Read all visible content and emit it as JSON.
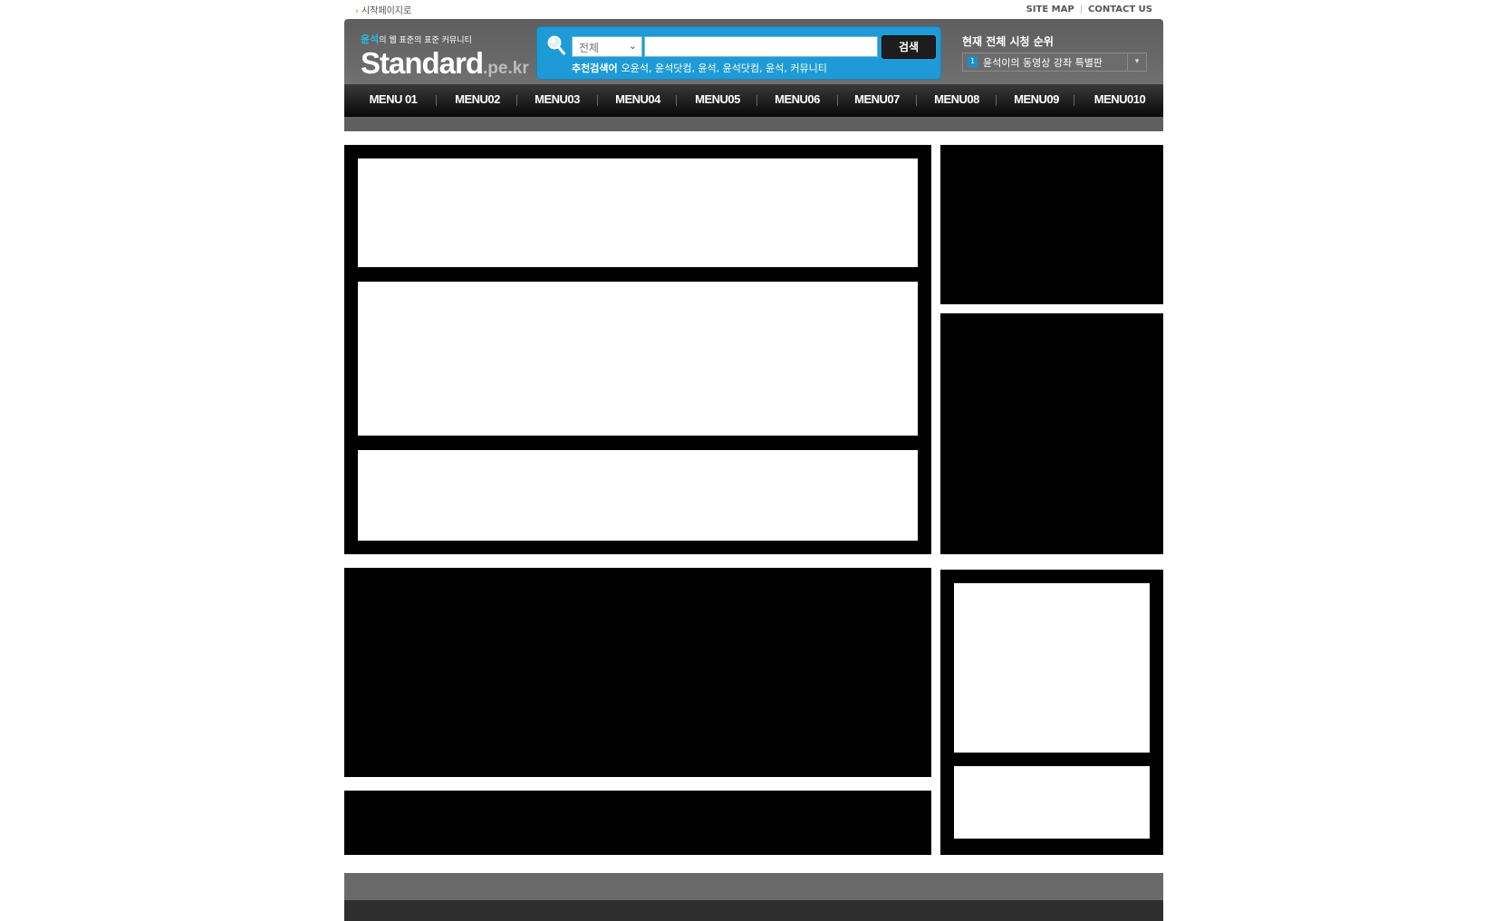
{
  "util": {
    "start_page": "시작페이지로",
    "site_map": "SITE MAP",
    "contact_us": "CONTACT US"
  },
  "logo": {
    "tagline_highlight": "윤석",
    "tagline_rest": "의 웹 표준의 표준 커뮤니티",
    "name_main": "Standard",
    "name_suffix": ".pe.kr"
  },
  "search": {
    "category": "전체",
    "button": "검색",
    "recommend_label": "추천검색어",
    "recommend_keywords": "오윤석, 윤석닷컴, 윤석, 윤석닷컴, 윤석, 커뮤니티"
  },
  "ranking": {
    "title": "현재 전체 시청 순위",
    "rank_number": "1",
    "item": "윤석이의 동영상 강좌 특별판"
  },
  "menu": [
    "MENU 01",
    "MENU02",
    "MENU03",
    "MENU04",
    "MENU05",
    "MENU06",
    "MENU07",
    "MENU08",
    "MENU09",
    "MENU010"
  ],
  "colors": {
    "search_blue": "#1e9bd6",
    "keyword_highlight": "#2bb8e8",
    "nav_black": "#080808",
    "footer_top": "#696969",
    "footer_bottom": "#2e2e2e"
  },
  "icons": {
    "search": "magnifier-icon",
    "bullet": "orange-arrow-icon",
    "dropdown": "chevron-down-icon"
  }
}
